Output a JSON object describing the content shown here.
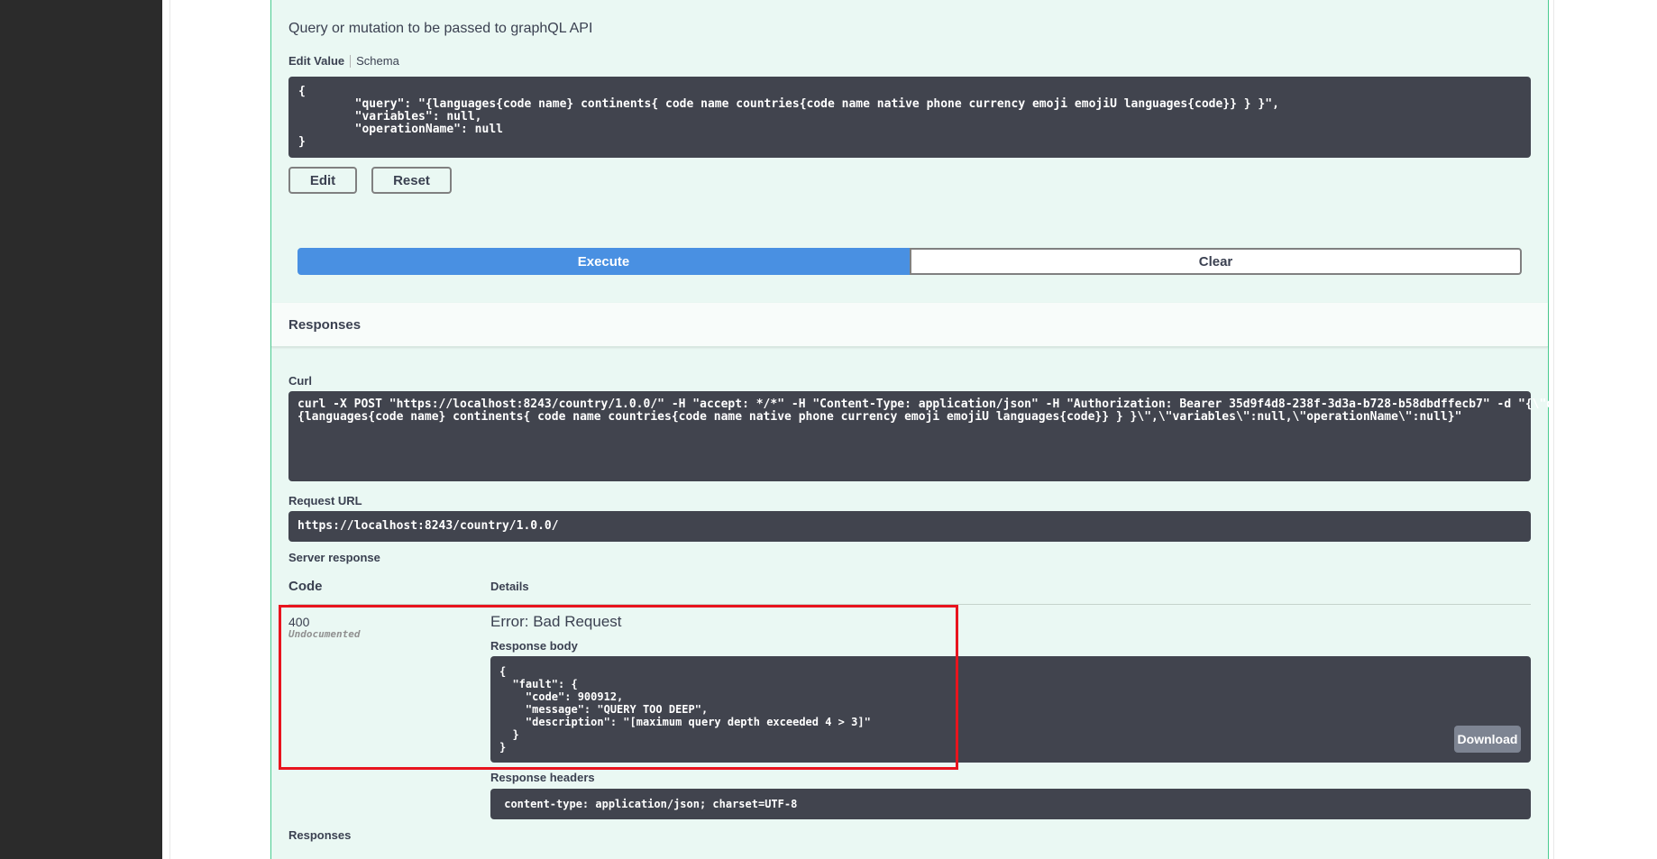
{
  "operation": {
    "description": "Query or mutation to be passed to graphQL API",
    "tabs": {
      "edit_value": "Edit Value",
      "schema": "Schema"
    },
    "body_value": "{\n        \"query\": \"{languages{code name} continents{ code name countries{code name native phone currency emoji emojiU languages{code}} } }\",\n        \"variables\": null,\n        \"operationName\": null\n}",
    "edit_label": "Edit",
    "reset_label": "Reset",
    "execute_label": "Execute",
    "clear_label": "Clear"
  },
  "responses": {
    "title": "Responses",
    "curl_label": "Curl",
    "curl_value": "curl -X POST \"https://localhost:8243/country/1.0.0/\" -H \"accept: */*\" -H \"Content-Type: application/json\" -H \"Authorization: Bearer 35d9f4d8-238f-3d3a-b728-b58dbdffecb7\" -d \"{\\\"query\\\":\\\"\n{languages{code name} continents{ code name countries{code name native phone currency emoji emojiU languages{code}} } }\\\",\\\"variables\\\":null,\\\"operationName\\\":null}\"",
    "request_url_label": "Request URL",
    "request_url": "https://localhost:8243/country/1.0.0/",
    "server_response_label": "Server response",
    "code_header": "Code",
    "details_header": "Details",
    "status_code": "400",
    "status_note": "Undocumented",
    "error_title": "Error: Bad Request",
    "response_body_label": "Response body",
    "response_body": "{\n  \"fault\": {\n    \"code\": 900912,\n    \"message\": \"QUERY TOO DEEP\",\n    \"description\": \"[maximum query depth exceeded 4 > 3]\"\n  }\n}",
    "download_label": "Download",
    "response_headers_label": "Response headers",
    "response_headers": " content-type: application/json; charset=UTF-8 ",
    "bottom_label": "Responses"
  },
  "colors": {
    "accent_post": "#49cc90",
    "execute": "#4990e2",
    "highlight": "#e8141e",
    "code_bg": "#41444e"
  }
}
